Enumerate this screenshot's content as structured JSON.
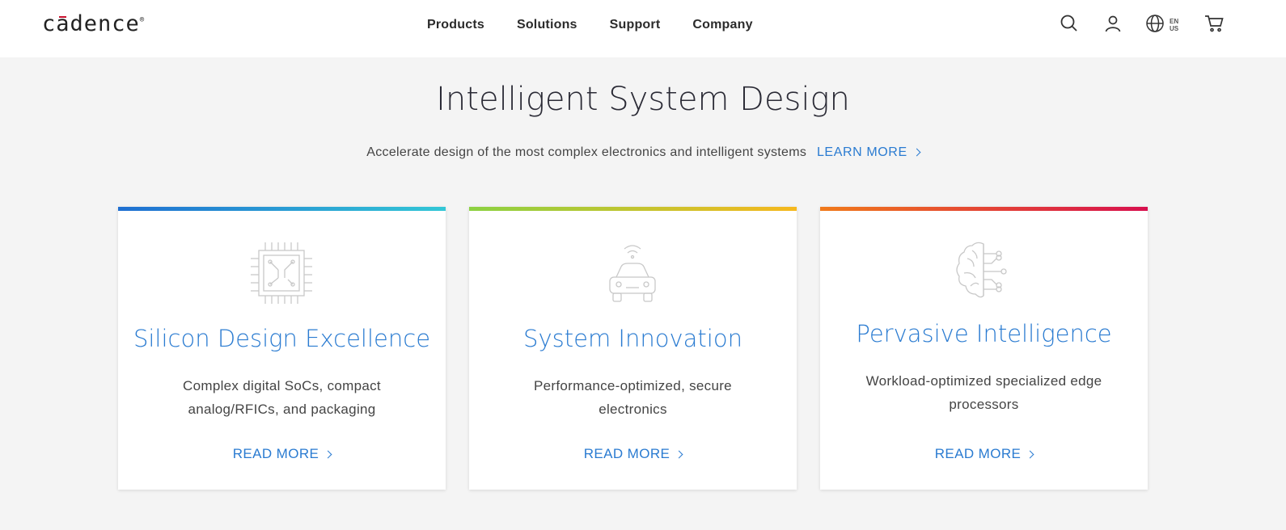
{
  "header": {
    "logo_text": "cadence",
    "nav": [
      "Products",
      "Solutions",
      "Support",
      "Company"
    ],
    "lang_top": "EN",
    "lang_bottom": "US"
  },
  "hero": {
    "title": "Intelligent System Design",
    "subtitle": "Accelerate design of the most complex electronics and intelligent systems",
    "learn_more": "LEARN MORE"
  },
  "cards": [
    {
      "title": "Silicon Design Excellence",
      "description": "Complex digital SoCs, compact analog/RFICs, and packaging",
      "link": "READ MORE",
      "icon": "chip-icon"
    },
    {
      "title": "System Innovation",
      "description": "Performance-optimized, secure electronics",
      "link": "READ MORE",
      "icon": "connected-car-icon"
    },
    {
      "title": "Pervasive Intelligence",
      "description": "Workload-optimized specialized edge processors",
      "link": "READ MORE",
      "icon": "brain-circuit-icon"
    }
  ],
  "colors": {
    "accent": "#2a7bd1",
    "card1_gradient": [
      "#1f6fd1",
      "#33c7d6"
    ],
    "card2_gradient": [
      "#8cd142",
      "#f6b81e"
    ],
    "card3_gradient": [
      "#f07a1b",
      "#d7104e"
    ]
  }
}
